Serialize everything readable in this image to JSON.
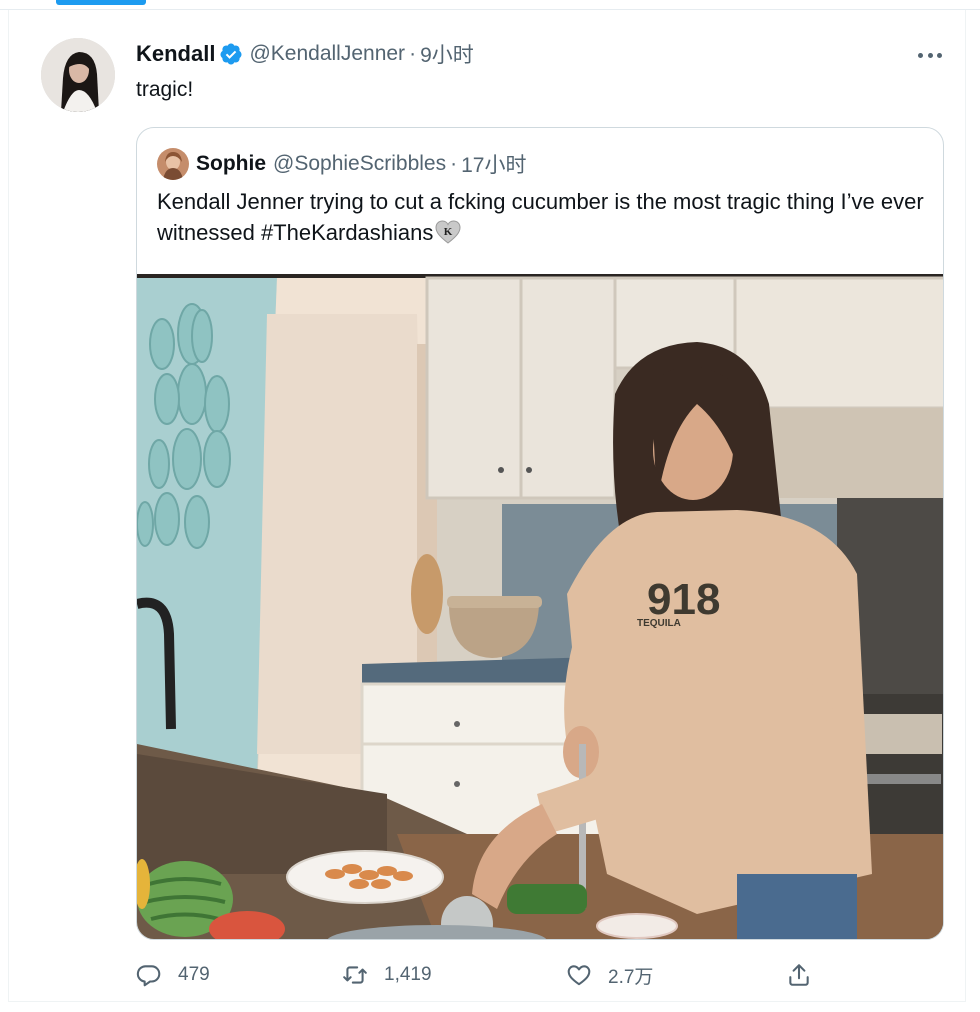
{
  "tweet": {
    "author_name": "Kendall",
    "author_handle": "@KendallJenner",
    "separator": "·",
    "time": "9小时",
    "text": "tragic!",
    "verified": true
  },
  "quoted_tweet": {
    "author_name": "Sophie",
    "author_handle": "@SophieScribbles",
    "separator": "·",
    "time": "17小时",
    "text": "Kendall Jenner trying to cut a fcking cucumber is the most tragic thing I’ve ever witnessed #TheKardashians",
    "hashtag_emoji": "heart-k-icon"
  },
  "actions": {
    "reply_count": "479",
    "retweet_count": "1,419",
    "like_count": "2.7万",
    "share_label": ""
  },
  "icons": [
    "verified-badge-icon",
    "more-icon",
    "reply-icon",
    "retweet-icon",
    "like-icon",
    "share-icon"
  ],
  "colors": {
    "accent": "#1d9bf0",
    "secondary_text": "#536471",
    "primary_text": "#0f1419",
    "border": "#cfd9de"
  }
}
